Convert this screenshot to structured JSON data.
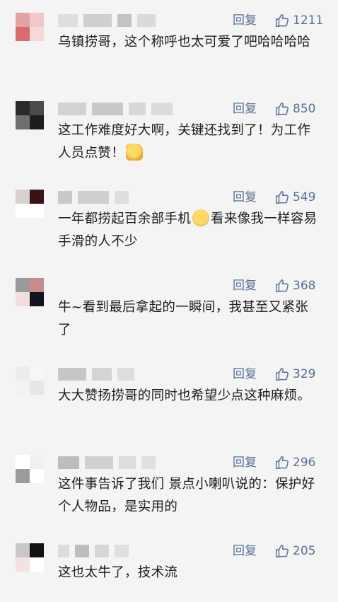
{
  "ui": {
    "reply_label": "回复"
  },
  "comments": [
    {
      "likes": "1211",
      "text": "乌镇捞哥，这个称呼也太可爱了吧哈哈哈哈",
      "emoji": "",
      "text_after": ""
    },
    {
      "likes": "850",
      "text": "这工作难度好大啊，关键还找到了！为工作人员点赞！",
      "emoji": "thumbs-up-emoji",
      "text_after": ""
    },
    {
      "likes": "549",
      "text": "一年都捞起百余部手机",
      "emoji": "crying-laughing-emoji",
      "text_after": "看来像我一样容易手滑的人不少"
    },
    {
      "likes": "368",
      "text": "牛~看到最后拿起的一瞬间，我甚至又紧张了",
      "emoji": "",
      "text_after": ""
    },
    {
      "likes": "329",
      "text": "大大赞扬捞哥的同时也希望少点这种麻烦。",
      "emoji": "",
      "text_after": ""
    },
    {
      "likes": "296",
      "text": "这件事告诉了我们 景点小喇叭说的：保护好个人物品，是实用的",
      "emoji": "",
      "text_after": ""
    },
    {
      "likes": "205",
      "text": "这也太牛了，技术流",
      "emoji": "",
      "text_after": ""
    }
  ]
}
